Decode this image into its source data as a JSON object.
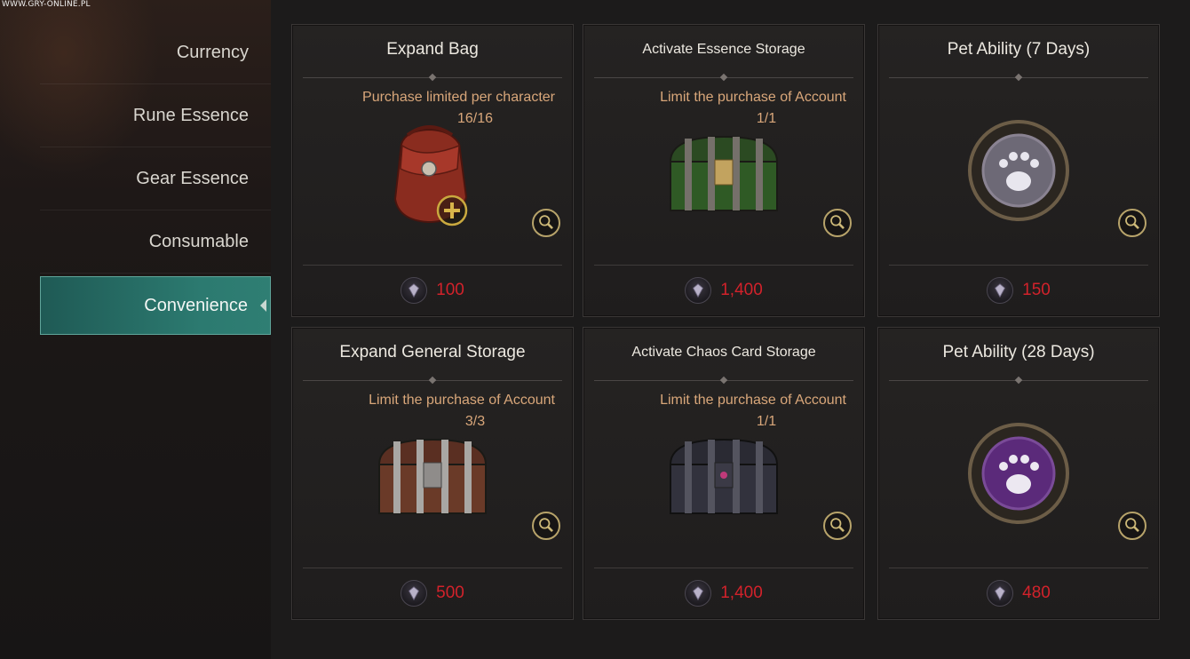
{
  "watermark": "WWW.GRY-ONLINE.PL",
  "sidebar": {
    "items": [
      {
        "label": "Currency"
      },
      {
        "label": "Rune Essence"
      },
      {
        "label": "Gear Essence"
      },
      {
        "label": "Consumable"
      },
      {
        "label": "Convenience"
      }
    ],
    "active_index": 4
  },
  "cards": [
    {
      "title": "Expand Bag",
      "limit": "Purchase limited per character",
      "count": "16/16",
      "price": "100",
      "icon": "bag-icon"
    },
    {
      "title": "Activate Essence Storage",
      "limit": "Limit the purchase of Account",
      "count": "1/1",
      "price": "1,400",
      "icon": "green-chest-icon"
    },
    {
      "title": "Pet Ability (7 Days)",
      "limit": "",
      "count": "",
      "price": "150",
      "icon": "paw-medallion-icon"
    },
    {
      "title": "Expand General Storage",
      "limit": "Limit the purchase of Account",
      "count": "3/3",
      "price": "500",
      "icon": "brown-chest-icon"
    },
    {
      "title": "Activate Chaos Card Storage",
      "limit": "Limit the purchase of Account",
      "count": "1/1",
      "price": "1,400",
      "icon": "dark-chest-icon"
    },
    {
      "title": "Pet Ability (28 Days)",
      "limit": "",
      "count": "",
      "price": "480",
      "icon": "paw-medallion-purple-icon"
    }
  ],
  "colors": {
    "accent_active": "#2c7a70",
    "price": "#d2222b",
    "limit_text": "#d9a77a"
  }
}
